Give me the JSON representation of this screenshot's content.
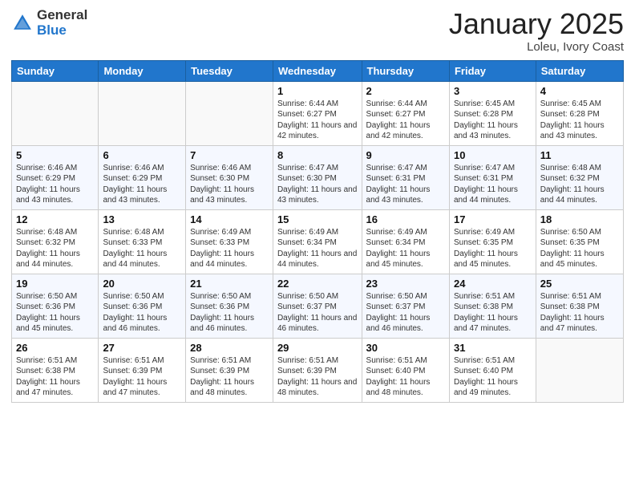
{
  "header": {
    "logo_general": "General",
    "logo_blue": "Blue",
    "title": "January 2025",
    "location": "Loleu, Ivory Coast"
  },
  "weekdays": [
    "Sunday",
    "Monday",
    "Tuesday",
    "Wednesday",
    "Thursday",
    "Friday",
    "Saturday"
  ],
  "weeks": [
    [
      {
        "day": "",
        "info": ""
      },
      {
        "day": "",
        "info": ""
      },
      {
        "day": "",
        "info": ""
      },
      {
        "day": "1",
        "info": "Sunrise: 6:44 AM\nSunset: 6:27 PM\nDaylight: 11 hours and 42 minutes."
      },
      {
        "day": "2",
        "info": "Sunrise: 6:44 AM\nSunset: 6:27 PM\nDaylight: 11 hours and 42 minutes."
      },
      {
        "day": "3",
        "info": "Sunrise: 6:45 AM\nSunset: 6:28 PM\nDaylight: 11 hours and 43 minutes."
      },
      {
        "day": "4",
        "info": "Sunrise: 6:45 AM\nSunset: 6:28 PM\nDaylight: 11 hours and 43 minutes."
      }
    ],
    [
      {
        "day": "5",
        "info": "Sunrise: 6:46 AM\nSunset: 6:29 PM\nDaylight: 11 hours and 43 minutes."
      },
      {
        "day": "6",
        "info": "Sunrise: 6:46 AM\nSunset: 6:29 PM\nDaylight: 11 hours and 43 minutes."
      },
      {
        "day": "7",
        "info": "Sunrise: 6:46 AM\nSunset: 6:30 PM\nDaylight: 11 hours and 43 minutes."
      },
      {
        "day": "8",
        "info": "Sunrise: 6:47 AM\nSunset: 6:30 PM\nDaylight: 11 hours and 43 minutes."
      },
      {
        "day": "9",
        "info": "Sunrise: 6:47 AM\nSunset: 6:31 PM\nDaylight: 11 hours and 43 minutes."
      },
      {
        "day": "10",
        "info": "Sunrise: 6:47 AM\nSunset: 6:31 PM\nDaylight: 11 hours and 44 minutes."
      },
      {
        "day": "11",
        "info": "Sunrise: 6:48 AM\nSunset: 6:32 PM\nDaylight: 11 hours and 44 minutes."
      }
    ],
    [
      {
        "day": "12",
        "info": "Sunrise: 6:48 AM\nSunset: 6:32 PM\nDaylight: 11 hours and 44 minutes."
      },
      {
        "day": "13",
        "info": "Sunrise: 6:48 AM\nSunset: 6:33 PM\nDaylight: 11 hours and 44 minutes."
      },
      {
        "day": "14",
        "info": "Sunrise: 6:49 AM\nSunset: 6:33 PM\nDaylight: 11 hours and 44 minutes."
      },
      {
        "day": "15",
        "info": "Sunrise: 6:49 AM\nSunset: 6:34 PM\nDaylight: 11 hours and 44 minutes."
      },
      {
        "day": "16",
        "info": "Sunrise: 6:49 AM\nSunset: 6:34 PM\nDaylight: 11 hours and 45 minutes."
      },
      {
        "day": "17",
        "info": "Sunrise: 6:49 AM\nSunset: 6:35 PM\nDaylight: 11 hours and 45 minutes."
      },
      {
        "day": "18",
        "info": "Sunrise: 6:50 AM\nSunset: 6:35 PM\nDaylight: 11 hours and 45 minutes."
      }
    ],
    [
      {
        "day": "19",
        "info": "Sunrise: 6:50 AM\nSunset: 6:36 PM\nDaylight: 11 hours and 45 minutes."
      },
      {
        "day": "20",
        "info": "Sunrise: 6:50 AM\nSunset: 6:36 PM\nDaylight: 11 hours and 46 minutes."
      },
      {
        "day": "21",
        "info": "Sunrise: 6:50 AM\nSunset: 6:36 PM\nDaylight: 11 hours and 46 minutes."
      },
      {
        "day": "22",
        "info": "Sunrise: 6:50 AM\nSunset: 6:37 PM\nDaylight: 11 hours and 46 minutes."
      },
      {
        "day": "23",
        "info": "Sunrise: 6:50 AM\nSunset: 6:37 PM\nDaylight: 11 hours and 46 minutes."
      },
      {
        "day": "24",
        "info": "Sunrise: 6:51 AM\nSunset: 6:38 PM\nDaylight: 11 hours and 47 minutes."
      },
      {
        "day": "25",
        "info": "Sunrise: 6:51 AM\nSunset: 6:38 PM\nDaylight: 11 hours and 47 minutes."
      }
    ],
    [
      {
        "day": "26",
        "info": "Sunrise: 6:51 AM\nSunset: 6:38 PM\nDaylight: 11 hours and 47 minutes."
      },
      {
        "day": "27",
        "info": "Sunrise: 6:51 AM\nSunset: 6:39 PM\nDaylight: 11 hours and 47 minutes."
      },
      {
        "day": "28",
        "info": "Sunrise: 6:51 AM\nSunset: 6:39 PM\nDaylight: 11 hours and 48 minutes."
      },
      {
        "day": "29",
        "info": "Sunrise: 6:51 AM\nSunset: 6:39 PM\nDaylight: 11 hours and 48 minutes."
      },
      {
        "day": "30",
        "info": "Sunrise: 6:51 AM\nSunset: 6:40 PM\nDaylight: 11 hours and 48 minutes."
      },
      {
        "day": "31",
        "info": "Sunrise: 6:51 AM\nSunset: 6:40 PM\nDaylight: 11 hours and 49 minutes."
      },
      {
        "day": "",
        "info": ""
      }
    ]
  ]
}
